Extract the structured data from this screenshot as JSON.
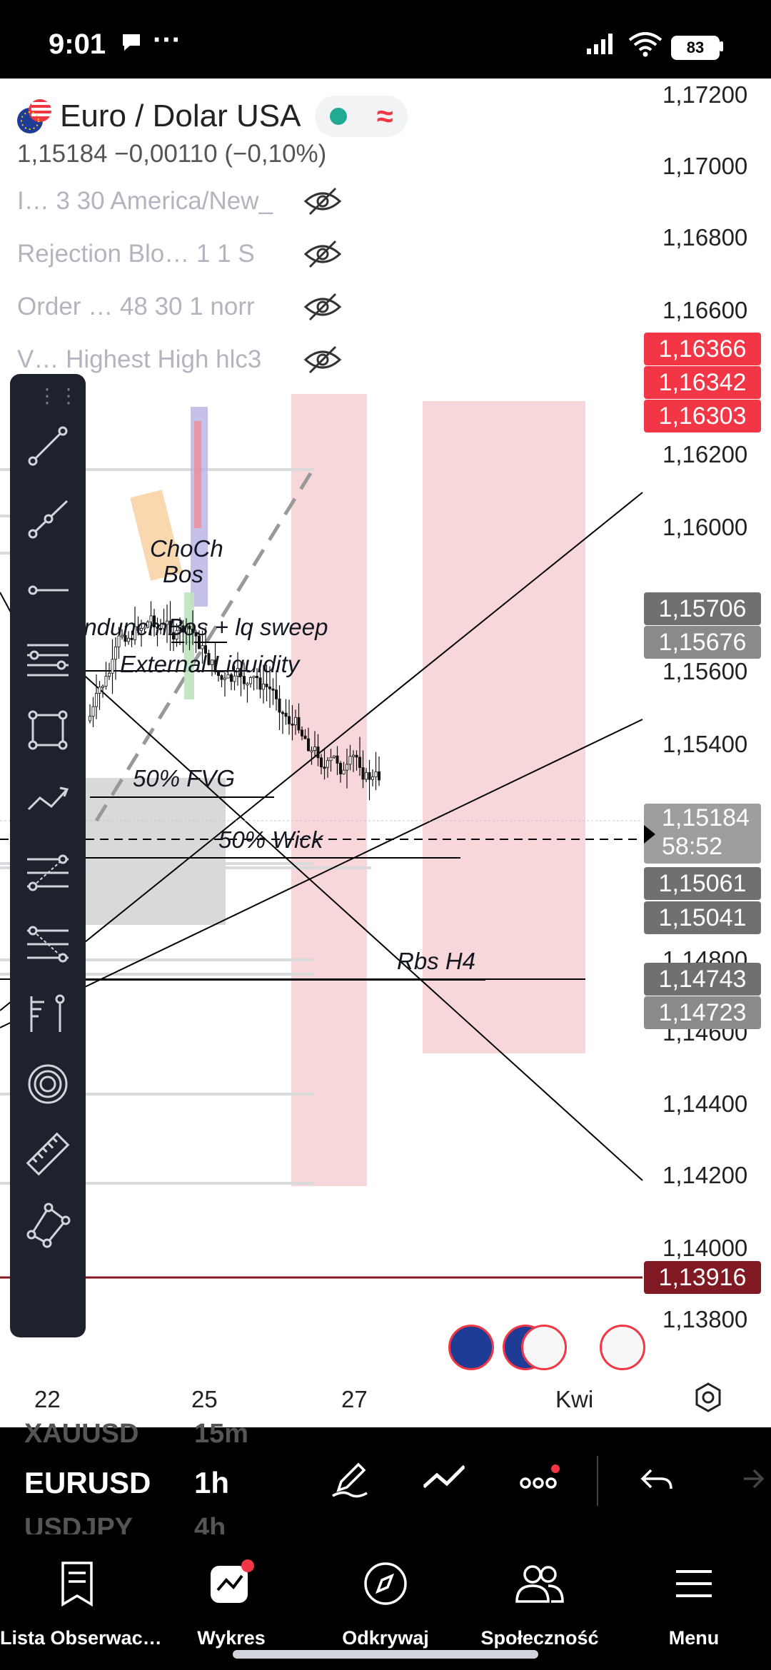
{
  "status_bar": {
    "time": "9:01",
    "more": "···",
    "battery": "83"
  },
  "symbol_header": {
    "title": "Euro / Dolar USA",
    "quote": "1,15184  −0,00110 (−0,10%)",
    "indicators": [
      {
        "label": "I… 3 30 America/New_"
      },
      {
        "label": "Rejection Blo…  1 1 S"
      },
      {
        "label": "Order … 48 30 1 norr"
      },
      {
        "label": "V… Highest High hlc3"
      }
    ]
  },
  "price_axis": {
    "labels": [
      "1,17200",
      "1,17000",
      "1,16800",
      "1,16600",
      "1,16200",
      "1,16000",
      "1,15600",
      "1,15400",
      "1,14800",
      "1,14600",
      "1,14400",
      "1,14200",
      "1,14000",
      "1,13800"
    ],
    "badges": [
      {
        "value": "1,16366",
        "style": "red"
      },
      {
        "value": "1,16342",
        "style": "red"
      },
      {
        "value": "1,16303",
        "style": "red"
      },
      {
        "value": "1,15706",
        "style": "darkgrey"
      },
      {
        "value": "1,15676",
        "style": "grey"
      },
      {
        "value": "1,15061",
        "style": "darkgrey"
      },
      {
        "value": "1,15041",
        "style": "darkgrey"
      },
      {
        "value": "1,14743",
        "style": "darkgrey"
      },
      {
        "value": "1,14723",
        "style": "grey"
      },
      {
        "value": "1,13916",
        "style": "maroon"
      }
    ],
    "current": {
      "price": "1,15184",
      "countdown": "58:52"
    }
  },
  "annotations": {
    "choch": "ChoCh",
    "bos": "Bos",
    "indunc": "induncmBos + lq sweep",
    "ext_liq": "External Liquidity",
    "fvg": "50% FVG",
    "wick": "50% Wick",
    "rbs": "Rbs H4"
  },
  "time_axis": {
    "labels": [
      "22",
      "25",
      "27",
      "Kwi"
    ]
  },
  "toolbar": {
    "tools": [
      "trend-line",
      "ray",
      "horizontal-ray",
      "parallel-lines",
      "rectangle",
      "path",
      "fib-retracement",
      "fib-extension",
      "long-position",
      "circles",
      "ruler",
      "polygon"
    ]
  },
  "bottom_bar": {
    "prev_symbol": "XAUUSD",
    "prev_tf": "15m",
    "symbol": "EURUSD",
    "timeframe": "1h",
    "next_symbol": "USDJPY",
    "next_tf": "4h"
  },
  "nav": {
    "items": [
      {
        "label": "Lista Obserwac…"
      },
      {
        "label": "Wykres"
      },
      {
        "label": "Odkrywaj"
      },
      {
        "label": "Społeczność"
      },
      {
        "label": "Menu"
      }
    ]
  },
  "colors": {
    "red": "#f23645",
    "maroon": "#801922",
    "zone": "#f8d7da",
    "toolbar": "#1e222d"
  }
}
